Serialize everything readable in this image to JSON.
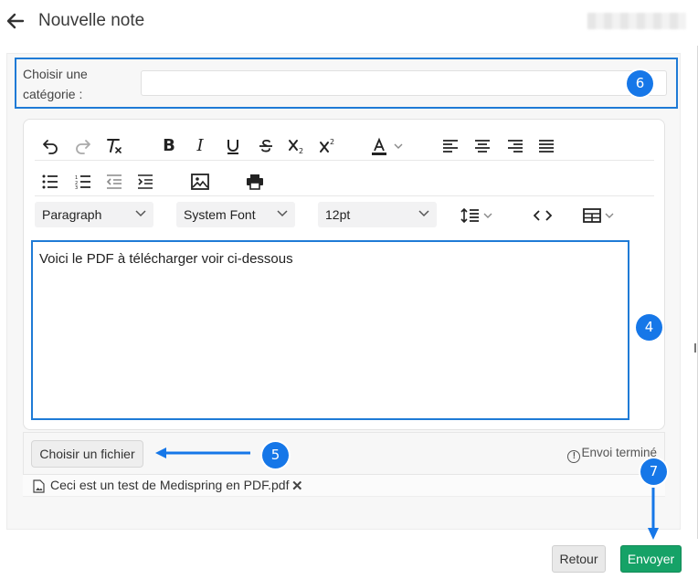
{
  "header": {
    "title": "Nouvelle note",
    "back_icon": "arrow-left-icon"
  },
  "category": {
    "label": "Choisir une catégorie :",
    "value": ""
  },
  "toolbar": {
    "block_format": "Paragraph",
    "font_family": "System Font",
    "font_size": "12pt",
    "icons_row1": [
      "undo-icon",
      "redo-icon",
      "clear-format-icon",
      "bold-icon",
      "italic-icon",
      "underline-icon",
      "strikethrough-icon",
      "subscript-icon",
      "superscript-icon",
      "text-color-icon",
      "align-left-icon",
      "align-center-icon",
      "align-right-icon",
      "align-justify-icon"
    ],
    "icons_row2": [
      "bullet-list-icon",
      "numbered-list-icon",
      "outdent-icon",
      "indent-icon",
      "image-icon",
      "print-icon"
    ],
    "icons_row3": [
      "line-height-icon",
      "code-icon",
      "table-icon"
    ]
  },
  "editor": {
    "content": "Voici le PDF à télécharger voir ci-dessous"
  },
  "file_upload": {
    "button_label": "Choisir un fichier",
    "status_text": "Envoi terminé",
    "attachment_name": "Ceci est un test de Medispring en PDF.pdf"
  },
  "footer": {
    "back_label": "Retour",
    "send_label": "Envoyer"
  },
  "annotations": {
    "badge_category": "6",
    "badge_editor": "4",
    "badge_file": "5",
    "badge_send": "7"
  },
  "colors": {
    "accent_blue": "#1f7bd6",
    "badge_blue": "#1677e8",
    "send_green": "#16a267"
  }
}
